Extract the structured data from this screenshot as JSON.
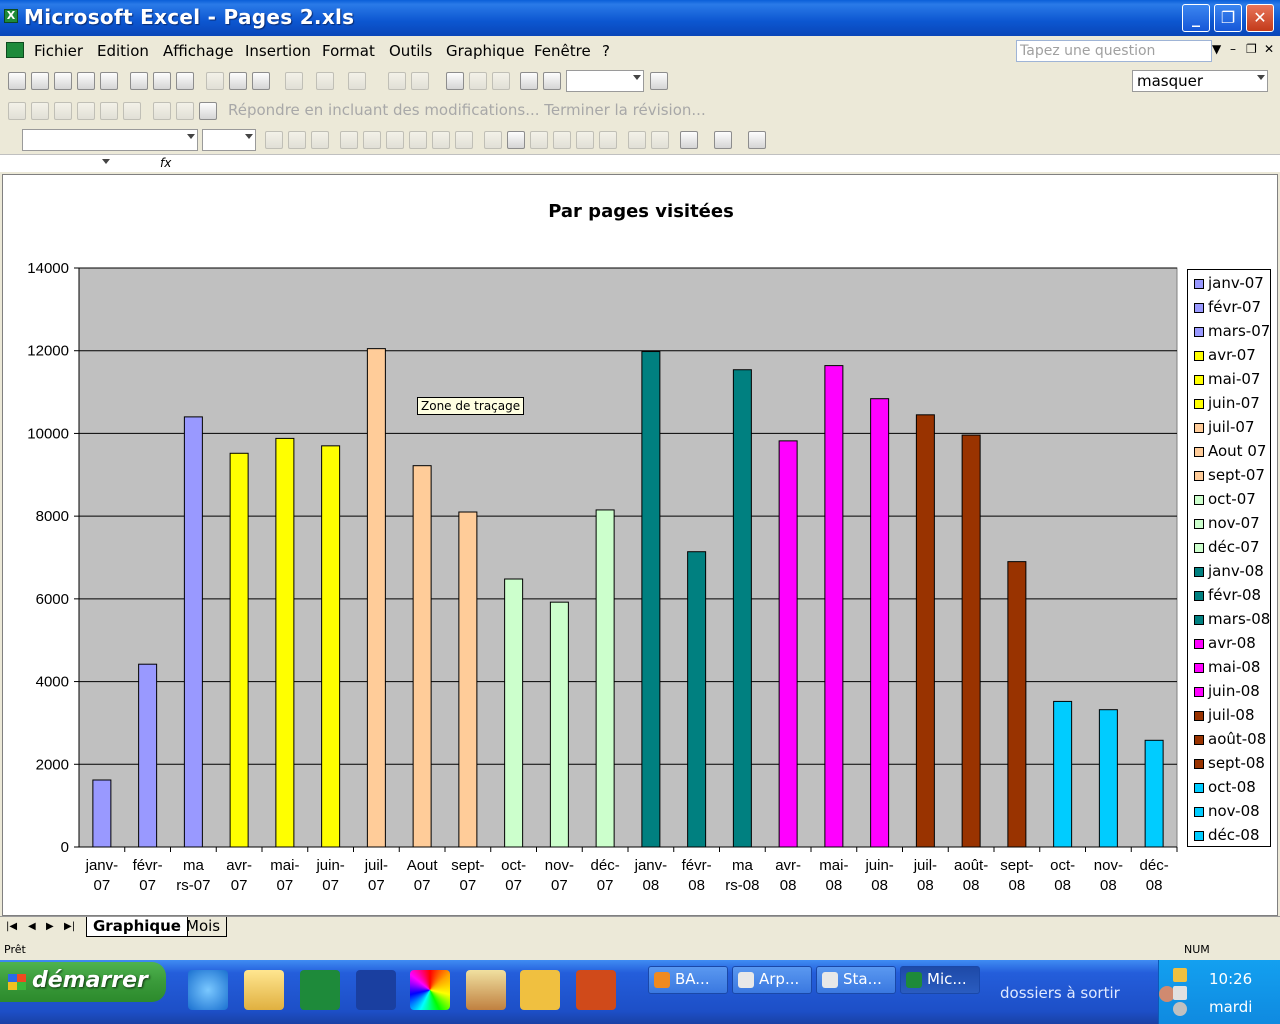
{
  "window": {
    "title": "Microsoft Excel - Pages 2.xls"
  },
  "menu": {
    "items": [
      "Fichier",
      "Edition",
      "Affichage",
      "Insertion",
      "Format",
      "Outils",
      "Graphique",
      "Fenêtre",
      "?"
    ],
    "ask_placeholder": "Tapez une question"
  },
  "toolbar": {
    "masquer_value": "masquer",
    "review_text": "Répondre en incluant des modifications... Terminer la révision..."
  },
  "formula": {
    "fx_label": "fx"
  },
  "tooltip": {
    "text": "Zone de traçage"
  },
  "sheets": {
    "tabs": [
      "Graphique",
      "Mois"
    ],
    "active": "Graphique"
  },
  "status": {
    "left": "Prêt",
    "right": "NUM"
  },
  "taskbar": {
    "start_label": "démarrer",
    "buttons": [
      "BA...",
      "Arp...",
      "Sta...",
      "Mic..."
    ],
    "folder_label": "dossiers à sortir",
    "time": "10:26",
    "day": "mardi"
  },
  "chart_data": {
    "type": "bar",
    "title": "Par pages visitées",
    "xlabel": "",
    "ylabel": "",
    "ylim": [
      0,
      14000
    ],
    "yticks": [
      0,
      2000,
      4000,
      6000,
      8000,
      10000,
      12000,
      14000
    ],
    "grid": true,
    "legend": "right",
    "categories": [
      "janv-07",
      "févr-07",
      "mars-07",
      "avr-07",
      "mai-07",
      "juin-07",
      "juil-07",
      "Aout 07",
      "sept-07",
      "oct-07",
      "nov-07",
      "déc-07",
      "janv-08",
      "févr-08",
      "mars-08",
      "avr-08",
      "mai-08",
      "juin-08",
      "juil-08",
      "août-08",
      "sept-08",
      "oct-08",
      "nov-08",
      "déc-08"
    ],
    "tick_labels": [
      [
        "janv-",
        "07"
      ],
      [
        "févr-",
        "07"
      ],
      [
        "ma",
        "rs-07"
      ],
      [
        "avr-",
        "07"
      ],
      [
        "mai-",
        "07"
      ],
      [
        "juin-",
        "07"
      ],
      [
        "juil-",
        "07"
      ],
      [
        "Aout",
        "07"
      ],
      [
        "sept-",
        "07"
      ],
      [
        "oct-",
        "07"
      ],
      [
        "nov-",
        "07"
      ],
      [
        "déc-",
        "07"
      ],
      [
        "janv-",
        "08"
      ],
      [
        "févr-",
        "08"
      ],
      [
        "ma",
        "rs-08"
      ],
      [
        "avr-",
        "08"
      ],
      [
        "mai-",
        "08"
      ],
      [
        "juin-",
        "08"
      ],
      [
        "juil-",
        "08"
      ],
      [
        "août-",
        "08"
      ],
      [
        "sept-",
        "08"
      ],
      [
        "oct-",
        "08"
      ],
      [
        "nov-",
        "08"
      ],
      [
        "déc-",
        "08"
      ]
    ],
    "values": [
      1620,
      4420,
      10400,
      9520,
      9880,
      9700,
      12050,
      9220,
      8100,
      6480,
      5920,
      8150,
      11980,
      7140,
      11540,
      9820,
      11640,
      10840,
      10450,
      9960,
      6900,
      3520,
      3320,
      2580
    ],
    "colors": [
      "#9999ff",
      "#9999ff",
      "#9999ff",
      "#ffff00",
      "#ffff00",
      "#ffff00",
      "#ffcc99",
      "#ffcc99",
      "#ffcc99",
      "#ccffcc",
      "#ccffcc",
      "#ccffcc",
      "#008080",
      "#008080",
      "#008080",
      "#ff00ff",
      "#ff00ff",
      "#ff00ff",
      "#993300",
      "#993300",
      "#993300",
      "#00ccff",
      "#00ccff",
      "#00ccff"
    ],
    "plot_background": "#c0c0c0"
  }
}
